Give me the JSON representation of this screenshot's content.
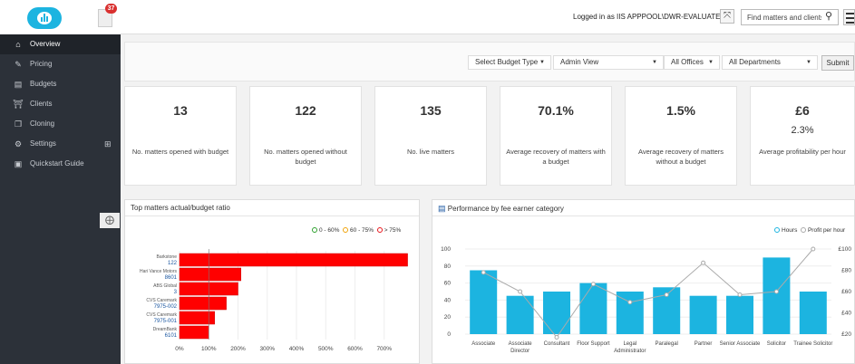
{
  "topbar": {
    "notification_count": "37",
    "logged_in_text": "Logged in as IIS APPPOOL\\DWR-EVALUATE ▾",
    "search_placeholder": "Find matters and clients"
  },
  "sidebar": {
    "items": [
      {
        "label": "Overview",
        "icon": "home-icon",
        "active": true
      },
      {
        "label": "Pricing",
        "icon": "edit-icon"
      },
      {
        "label": "Budgets",
        "icon": "bar-chart-icon"
      },
      {
        "label": "Clients",
        "icon": "bank-icon"
      },
      {
        "label": "Cloning",
        "icon": "copy-icon"
      },
      {
        "label": "Settings",
        "icon": "settings-icon"
      },
      {
        "label": "Quickstart Guide",
        "icon": "book-icon"
      }
    ]
  },
  "filters": {
    "budget_type": "Select Budget Type",
    "view": "Admin View",
    "offices": "All Offices",
    "departments": "All Departments",
    "submit_label": "Submit"
  },
  "kpis": [
    {
      "value": "13",
      "sub": "",
      "label": "No. matters opened with budget"
    },
    {
      "value": "122",
      "sub": "",
      "label": "No. matters opened without budget"
    },
    {
      "value": "135",
      "sub": "",
      "label": "No. live matters"
    },
    {
      "value": "70.1%",
      "sub": "",
      "label": "Average recovery of matters with a budget"
    },
    {
      "value": "1.5%",
      "sub": "",
      "label": "Average recovery of matters without a budget"
    },
    {
      "value": "£6",
      "sub": "2.3%",
      "label": "Average profitability per hour"
    }
  ],
  "panels": {
    "left_title": "Top matters actual/budget ratio",
    "right_title": "Performance by fee earner category",
    "left_legend": [
      "0 - 60%",
      "60 - 75%",
      "> 75%"
    ],
    "right_legend": [
      "Hours",
      "Profit per hour"
    ]
  },
  "chart_data": [
    {
      "type": "bar",
      "orientation": "horizontal",
      "title": "Top matters actual/budget ratio",
      "categories": [
        {
          "client": "Barkstone",
          "matter": "122"
        },
        {
          "client": "Hari Vance Motors",
          "matter": "8601"
        },
        {
          "client": "ABS Global",
          "matter": "3"
        },
        {
          "client": "CVS Caremark",
          "matter": "7975-002"
        },
        {
          "client": "CVS Caremark",
          "matter": "7975-001"
        },
        {
          "client": "DreamBank",
          "matter": "6101"
        }
      ],
      "values": [
        780,
        210,
        200,
        160,
        120,
        100
      ],
      "xticks": [
        "0%",
        "100%",
        "200%",
        "300%",
        "400%",
        "500%",
        "600%",
        "700%"
      ],
      "xlim": [
        0,
        800
      ],
      "legend": [
        "0 - 60%",
        "60 - 75%",
        "> 75%"
      ],
      "colors": {
        "low": "#2ca02c",
        "mid": "#f0a30a",
        "high": "#e8151b",
        "bar": "#ff0000"
      }
    },
    {
      "type": "bar+line",
      "title": "Performance by fee earner category",
      "categories": [
        "Associate",
        "Associate Director",
        "Consultant",
        "Floor Support",
        "Legal Administrator",
        "Paralegal",
        "Partner",
        "Senior Associate",
        "Solicitor",
        "Trainee Solicitor"
      ],
      "series": [
        {
          "name": "Hours",
          "type": "bar",
          "axis": "left",
          "values": [
            75,
            45,
            50,
            60,
            50,
            55,
            45,
            45,
            90,
            50
          ],
          "color": "#1cb4e0"
        },
        {
          "name": "Profit per hour",
          "type": "line",
          "axis": "right",
          "values": [
            78,
            60,
            17,
            67,
            50,
            57,
            87,
            57,
            60,
            100
          ],
          "color": "#aaaaaa"
        }
      ],
      "ylim": [
        0,
        100
      ],
      "yticks": [
        "0",
        "20",
        "40",
        "60",
        "80",
        "100"
      ],
      "y2lim": [
        20,
        100
      ],
      "y2ticks": [
        "£20",
        "£40",
        "£60",
        "£80",
        "£100"
      ]
    }
  ]
}
